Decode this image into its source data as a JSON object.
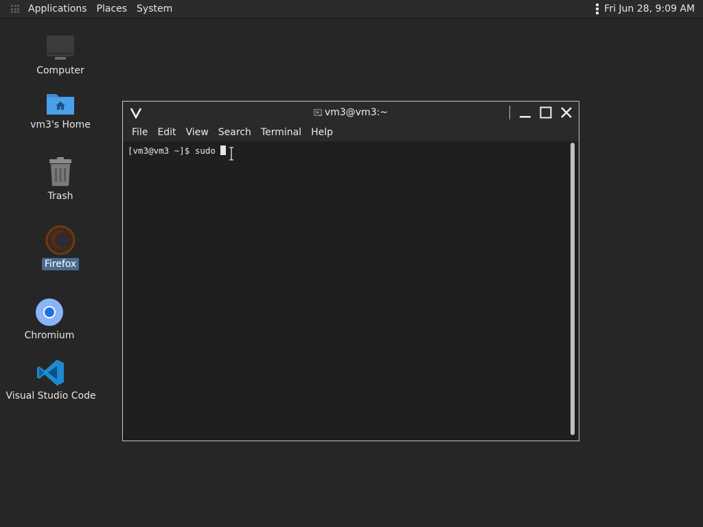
{
  "top_panel": {
    "menus": [
      "Applications",
      "Places",
      "System"
    ],
    "clock": "Fri Jun 28,  9:09 AM"
  },
  "desktop": {
    "icons": [
      {
        "label": "Computer",
        "icon": "computer-icon"
      },
      {
        "label": "vm3's Home",
        "icon": "home-folder-icon"
      },
      {
        "label": "Trash",
        "icon": "trash-icon"
      },
      {
        "label": "Firefox",
        "icon": "firefox-icon",
        "selected": true
      },
      {
        "label": "Chromium",
        "icon": "chromium-icon"
      },
      {
        "label": "Visual Studio Code",
        "icon": "vscode-icon"
      }
    ]
  },
  "terminal": {
    "title": "vm3@vm3:~",
    "menu": [
      "File",
      "Edit",
      "View",
      "Search",
      "Terminal",
      "Help"
    ],
    "prompt": "[vm3@vm3 ~]$ sudo "
  }
}
